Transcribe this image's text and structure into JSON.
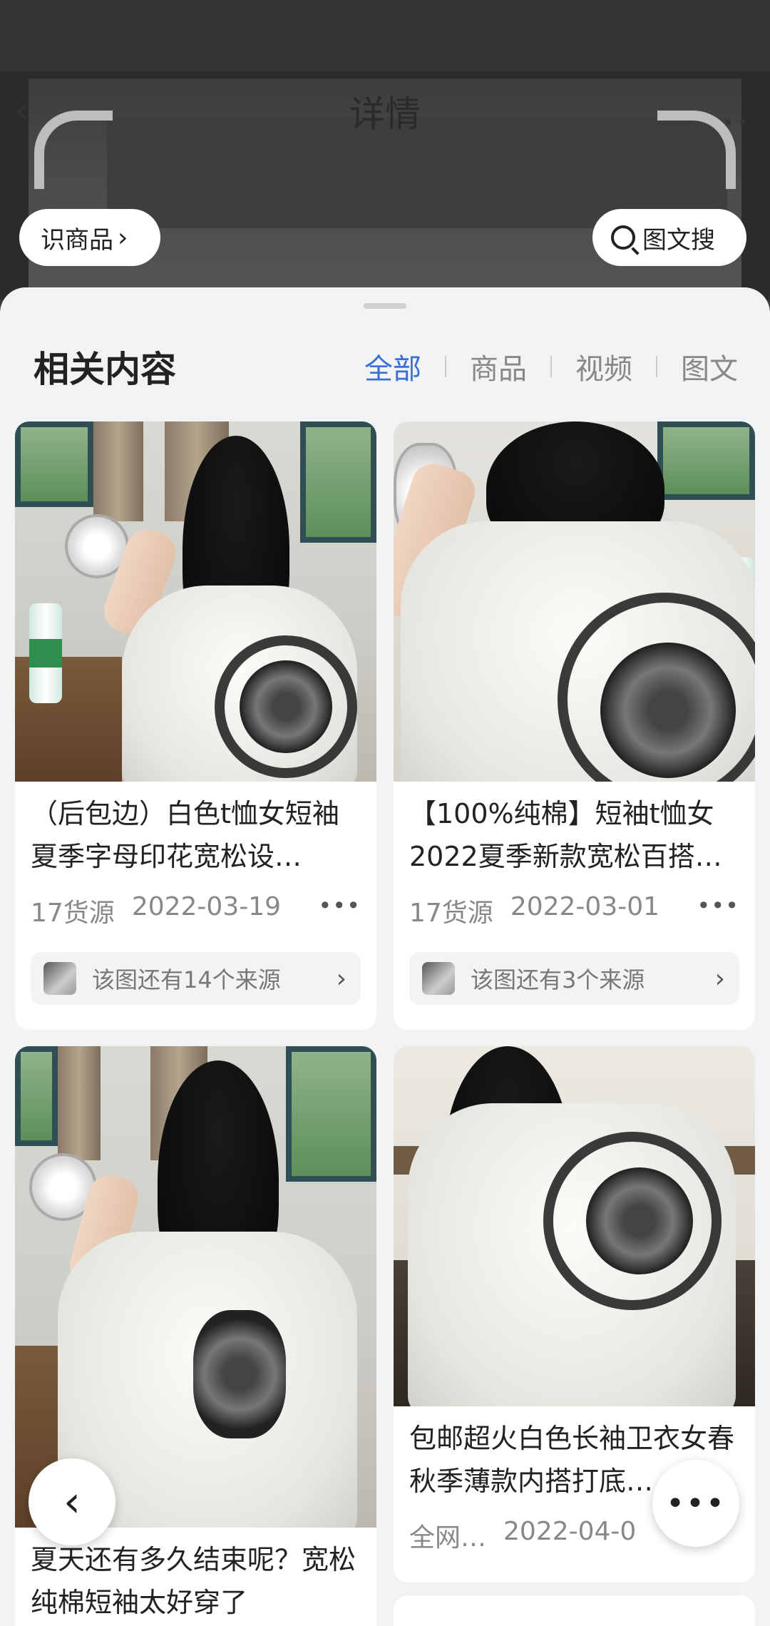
{
  "header": {
    "title": "详情"
  },
  "actions": {
    "identify_label": "识商品",
    "search_label": "图文搜"
  },
  "sheet": {
    "title": "相关内容",
    "tabs": [
      {
        "label": "全部",
        "active": true
      },
      {
        "label": "商品",
        "active": false
      },
      {
        "label": "视频",
        "active": false
      },
      {
        "label": "图文",
        "active": false
      }
    ]
  },
  "cards": [
    {
      "title": "（后包边）白色t恤女短袖夏季字母印花宽松设…",
      "sources": "17货源",
      "date": "2022-03-19",
      "more_sources": "该图还有14个来源"
    },
    {
      "title": "【100%纯棉】短袖t恤女2022夏季新款宽松百搭…",
      "sources": "17货源",
      "date": "2022-03-01",
      "more_sources": "该图还有3个来源"
    },
    {
      "title": "夏天还有多久结束呢？宽松纯棉短袖太好穿了"
    },
    {
      "title": "包邮超火白色长袖卫衣女春秋季薄款内搭打底…",
      "sources": "全网…",
      "date": "2022-04-0"
    }
  ],
  "colors": {
    "accent": "#3a6fd8",
    "sheet_bg": "#f2f3f5"
  }
}
